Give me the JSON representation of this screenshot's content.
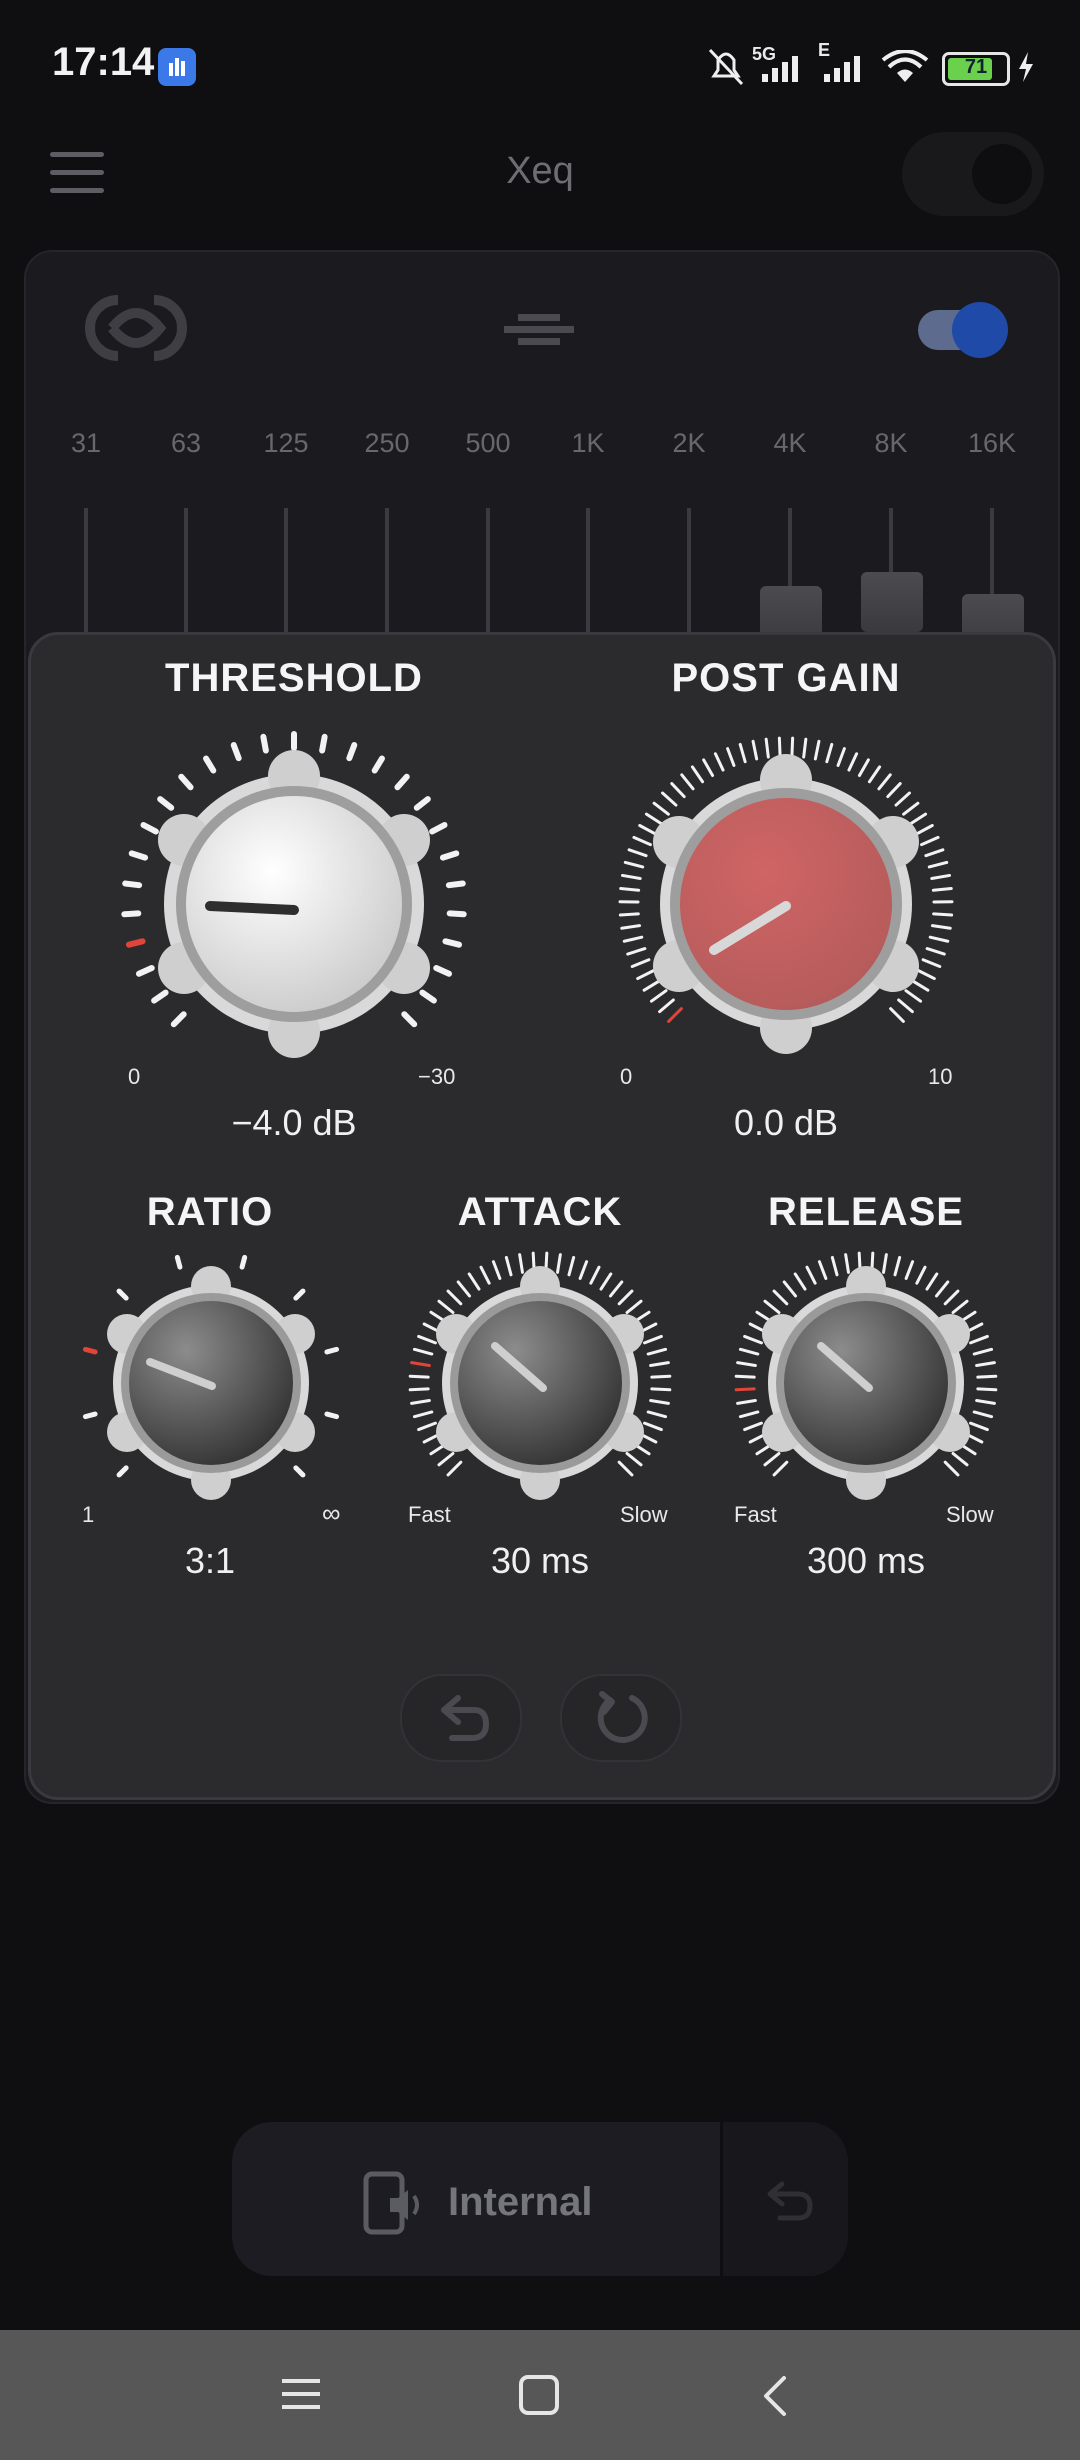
{
  "status_bar": {
    "time": "17:14",
    "network": "5G",
    "network_secondary": "E",
    "battery": "71",
    "icons": [
      "app-badge-icon",
      "mute-bell-icon",
      "signal-icon",
      "wifi-icon",
      "battery-icon",
      "charging-icon"
    ]
  },
  "header": {
    "title": "Xeq"
  },
  "equalizer": {
    "bands": [
      "31",
      "63",
      "125",
      "250",
      "500",
      "1K",
      "2K",
      "4K",
      "8K",
      "16K"
    ],
    "enabled": true
  },
  "compressor": {
    "threshold": {
      "label": "THRESHOLD",
      "value": "−4.0 dB",
      "min": "0",
      "max": "−30"
    },
    "post_gain": {
      "label": "POST GAIN",
      "value": "0.0 dB",
      "min": "0",
      "max": "10"
    },
    "ratio": {
      "label": "RATIO",
      "value": "3:1",
      "min": "1",
      "max": "∞"
    },
    "attack": {
      "label": "ATTACK",
      "value": "30 ms",
      "min": "Fast",
      "max": "Slow"
    },
    "release": {
      "label": "RELEASE",
      "value": "300 ms",
      "min": "Fast",
      "max": "Slow"
    }
  },
  "output": {
    "label": "Internal"
  },
  "colors": {
    "accent_red": "#e0453a",
    "knob_red": "#c95e5e",
    "toggle_blue": "#1f4aa8"
  }
}
